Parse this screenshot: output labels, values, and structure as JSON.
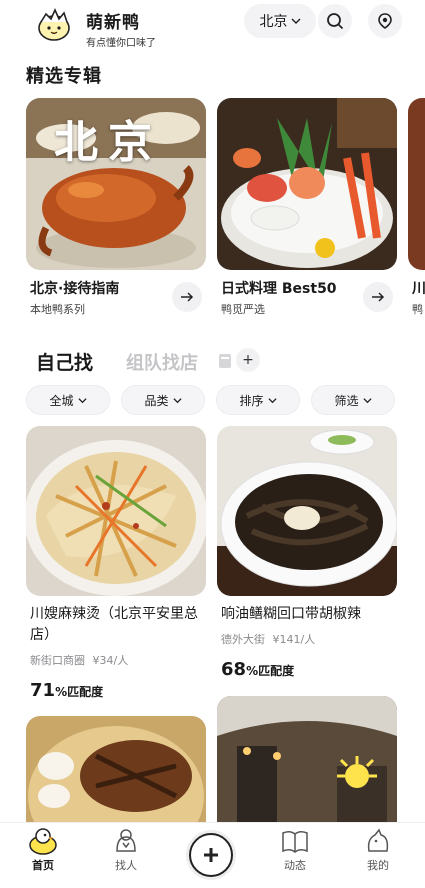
{
  "header": {
    "app_name": "萌新鸭",
    "slogan": "有点懂你口味了",
    "city": "北京",
    "icons": [
      "duck-logo-icon",
      "chevron-down-icon",
      "search-icon",
      "location-pin-icon"
    ]
  },
  "featured": {
    "section_title": "精选专辑",
    "cards": [
      {
        "title": "北京·接待指南",
        "subtitle": "本地鸭系列",
        "overlay": "北京"
      },
      {
        "title": "日式料理 Best50",
        "subtitle": "鸭觅严选"
      },
      {
        "title": "川",
        "subtitle": "鸭"
      }
    ]
  },
  "tabs": {
    "active": "自己找",
    "other": "组队找店",
    "add_label": "+"
  },
  "filters": [
    "全城",
    "品类",
    "排序",
    "筛选"
  ],
  "restaurants": [
    {
      "name": "川嫂麻辣烫（北京平安里总店）",
      "area": "新街口商圈",
      "price": "¥34/人",
      "match_value": "71",
      "match_label": "%匹配度"
    },
    {
      "name": "响油鳝糊回口带胡椒辣",
      "area": "德外大街",
      "price": "¥141/人",
      "match_value": "68",
      "match_label": "%匹配度"
    }
  ],
  "bottom_nav": [
    {
      "label": "首页",
      "icon": "duck-home-icon",
      "active": true
    },
    {
      "label": "找人",
      "icon": "people-icon",
      "active": false
    },
    {
      "label": "",
      "icon": "plus-icon",
      "active": false
    },
    {
      "label": "动态",
      "icon": "book-icon",
      "active": false
    },
    {
      "label": "我的",
      "icon": "profile-icon",
      "active": false
    }
  ],
  "colors": {
    "accent_yellow": "#ffe34d",
    "pill_bg": "#f3f3f5",
    "muted_text": "#8a8a8e"
  }
}
